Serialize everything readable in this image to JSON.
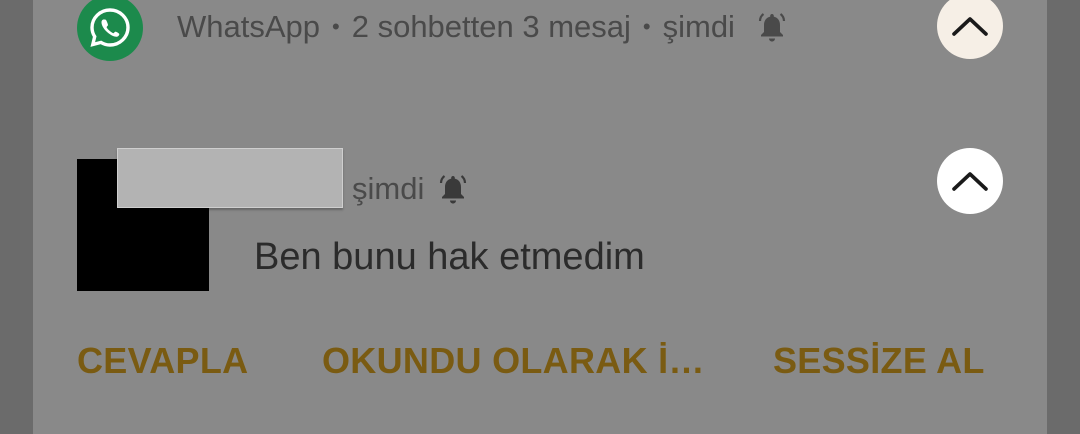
{
  "notification": {
    "app_name": "WhatsApp",
    "summary": "2 sohbetten 3 mesaj",
    "time": "şimdi",
    "separator": "•",
    "icons": {
      "app": "whatsapp-icon",
      "bell": "bell-icon",
      "collapse": "chevron-up-icon"
    }
  },
  "message": {
    "time": "şimdi",
    "text": "Ben bunu hak etmedim"
  },
  "actions": {
    "reply_label": "CEVAPLA",
    "mark_read_label": "OKUNDU OLARAK İ…",
    "mute_label": "SESSİZE AL"
  },
  "colors": {
    "scrim": "#6b6b6b",
    "card": "#898989",
    "whatsapp_green": "#1c8a4c",
    "action_text": "#7a5b12"
  }
}
